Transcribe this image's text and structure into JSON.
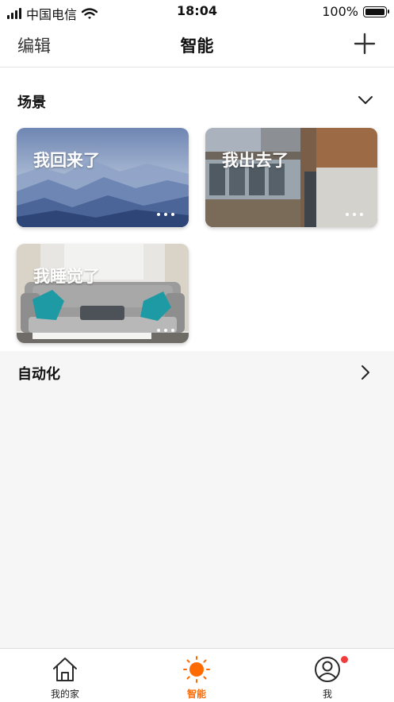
{
  "status_bar": {
    "carrier": "中国电信",
    "time": "18:04",
    "battery": "100%",
    "icons": [
      "signal-icon",
      "wifi-icon",
      "battery-icon"
    ]
  },
  "header": {
    "edit_label": "编辑",
    "title": "智能",
    "add_icon": "plus-icon"
  },
  "scenes": {
    "title": "场景",
    "toggle_icon": "chevron-down-icon",
    "items": [
      {
        "label": "我回来了",
        "image": "mountain-mist-photo"
      },
      {
        "label": "我出去了",
        "image": "building-facade-photo"
      },
      {
        "label": "我睡觉了",
        "image": "sofa-living-room-photo"
      }
    ],
    "more_icon": "more-dots-icon"
  },
  "automation": {
    "title": "自动化",
    "arrow_icon": "chevron-right-icon"
  },
  "tabbar": {
    "items": [
      {
        "label": "我的家",
        "icon": "home-icon",
        "active": false
      },
      {
        "label": "智能",
        "icon": "sun-icon",
        "active": true
      },
      {
        "label": "我",
        "icon": "user-circle-icon",
        "active": false,
        "badge": true
      }
    ]
  },
  "colors": {
    "accent": "#ff6a00",
    "badge": "#f23b3b",
    "page_background": "#f6f6f6"
  }
}
